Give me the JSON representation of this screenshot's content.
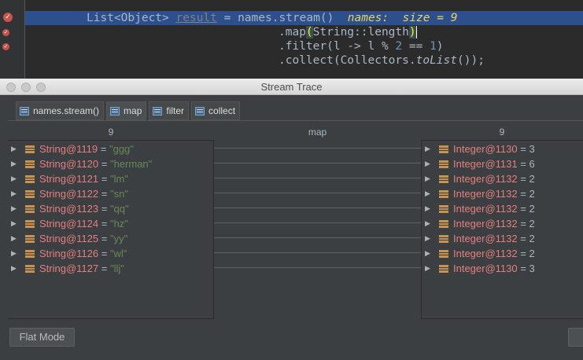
{
  "editor": {
    "lines": [
      {
        "parts": [
          {
            "t": "List<Object> ",
            "c": "kw-class"
          },
          {
            "t": "result",
            "c": "var-unused"
          },
          {
            "t": " = names.stream()  ",
            "c": ""
          },
          {
            "t": "names:  size = 9",
            "c": "debug-val"
          }
        ]
      },
      {
        "parts": [
          {
            "t": ".map",
            "c": ""
          },
          {
            "t": "(",
            "c": "brace-hl"
          },
          {
            "t": "String::length",
            "c": ""
          },
          {
            "t": ")",
            "c": "brace-hl"
          }
        ]
      },
      {
        "parts": [
          {
            "t": ".filter(l -> l % ",
            "c": ""
          },
          {
            "t": "2",
            "c": "num"
          },
          {
            "t": " == ",
            "c": ""
          },
          {
            "t": "1",
            "c": "num"
          },
          {
            "t": ")",
            "c": ""
          }
        ]
      },
      {
        "parts": [
          {
            "t": ".collect(Collectors.",
            "c": ""
          },
          {
            "t": "toList",
            "c": "method-it"
          },
          {
            "t": "());",
            "c": ""
          }
        ]
      }
    ]
  },
  "window": {
    "title": "Stream Trace",
    "tabs": [
      {
        "label": "names.stream()",
        "active": false
      },
      {
        "label": "map",
        "active": true
      },
      {
        "label": "filter",
        "active": false
      },
      {
        "label": "collect",
        "active": false
      }
    ],
    "left_header": "9",
    "center_header": "map",
    "right_header": "9",
    "left_items": [
      {
        "name": "String@1119",
        "value": "\"ggg\""
      },
      {
        "name": "String@1120",
        "value": "\"herman\""
      },
      {
        "name": "String@1121",
        "value": "\"lm\""
      },
      {
        "name": "String@1122",
        "value": "\"sn\""
      },
      {
        "name": "String@1123",
        "value": "\"qq\""
      },
      {
        "name": "String@1124",
        "value": "\"hz\""
      },
      {
        "name": "String@1125",
        "value": "\"yy\""
      },
      {
        "name": "String@1126",
        "value": "\"wl\""
      },
      {
        "name": "String@1127",
        "value": "\"llj\""
      }
    ],
    "right_items": [
      {
        "name": "Integer@1130",
        "value": "3"
      },
      {
        "name": "Integer@1131",
        "value": "6"
      },
      {
        "name": "Integer@1132",
        "value": "2"
      },
      {
        "name": "Integer@1132",
        "value": "2"
      },
      {
        "name": "Integer@1132",
        "value": "2"
      },
      {
        "name": "Integer@1132",
        "value": "2"
      },
      {
        "name": "Integer@1132",
        "value": "2"
      },
      {
        "name": "Integer@1132",
        "value": "2"
      },
      {
        "name": "Integer@1130",
        "value": "3"
      }
    ],
    "flat_mode_label": "Flat Mode"
  }
}
